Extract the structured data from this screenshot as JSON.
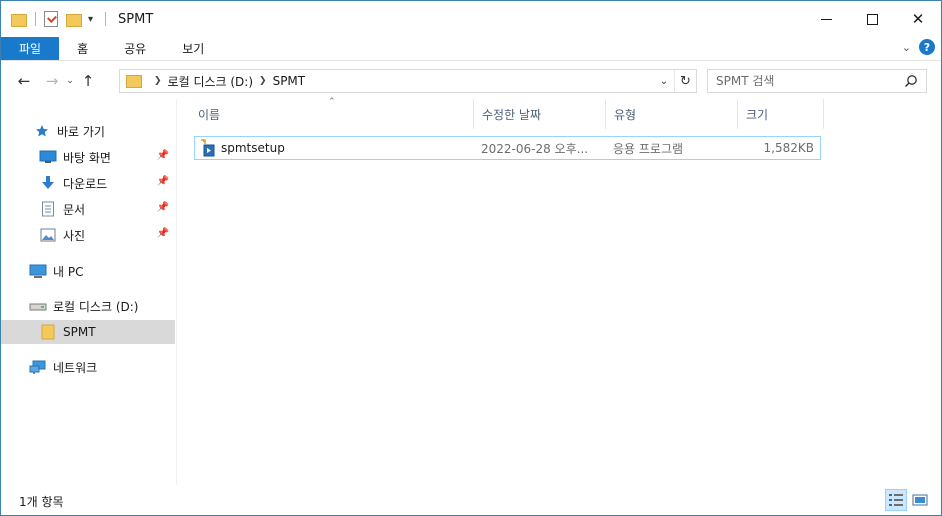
{
  "window": {
    "title": "SPMT",
    "controls": {
      "minimize_icon": "minimize-icon",
      "maximize_icon": "maximize-icon",
      "close_icon": "close-icon",
      "close_label": "✕"
    }
  },
  "ribbon": {
    "tabs": [
      {
        "label": "파일"
      },
      {
        "label": "홈"
      },
      {
        "label": "공유"
      },
      {
        "label": "보기"
      }
    ],
    "help_label": "?"
  },
  "navigation": {
    "back_glyph": "←",
    "forward_glyph": "→",
    "recent_glyph": "⌄",
    "up_glyph": "↑",
    "breadcrumbs": [
      {
        "label": "로컬 디스크 (D:)"
      },
      {
        "label": "SPMT"
      }
    ],
    "refresh_glyph": "↻"
  },
  "search": {
    "placeholder": "SPMT 검색",
    "value": ""
  },
  "sidebar": {
    "items": [
      {
        "label": "바로 가기",
        "icon": "star-icon"
      },
      {
        "label": "바탕 화면",
        "icon": "desktop-icon",
        "pinned": true
      },
      {
        "label": "다운로드",
        "icon": "download-icon",
        "pinned": true
      },
      {
        "label": "문서",
        "icon": "documents-icon",
        "pinned": true
      },
      {
        "label": "사진",
        "icon": "pictures-icon",
        "pinned": true
      },
      {
        "label": "내 PC",
        "icon": "computer-icon"
      },
      {
        "label": "로컬 디스크 (D:)",
        "icon": "drive-icon"
      },
      {
        "label": "SPMT",
        "icon": "folder-icon",
        "selected": true
      },
      {
        "label": "네트워크",
        "icon": "network-icon"
      }
    ]
  },
  "file_list": {
    "columns": [
      {
        "label": "이름"
      },
      {
        "label": "수정한 날짜"
      },
      {
        "label": "유형"
      },
      {
        "label": "크기"
      }
    ],
    "rows": [
      {
        "name": "spmtsetup",
        "modified": "2022-06-28 오후...",
        "type": "응용 프로그램",
        "size": "1,582KB",
        "icon": "setup-installer-icon"
      }
    ]
  },
  "status": {
    "item_count": "1개 항목"
  },
  "colors": {
    "accent": "#1979ca",
    "selected_row_border": "#99d1ff",
    "selected_nav": "#d9d9d9",
    "header_text": "#4c607a"
  }
}
